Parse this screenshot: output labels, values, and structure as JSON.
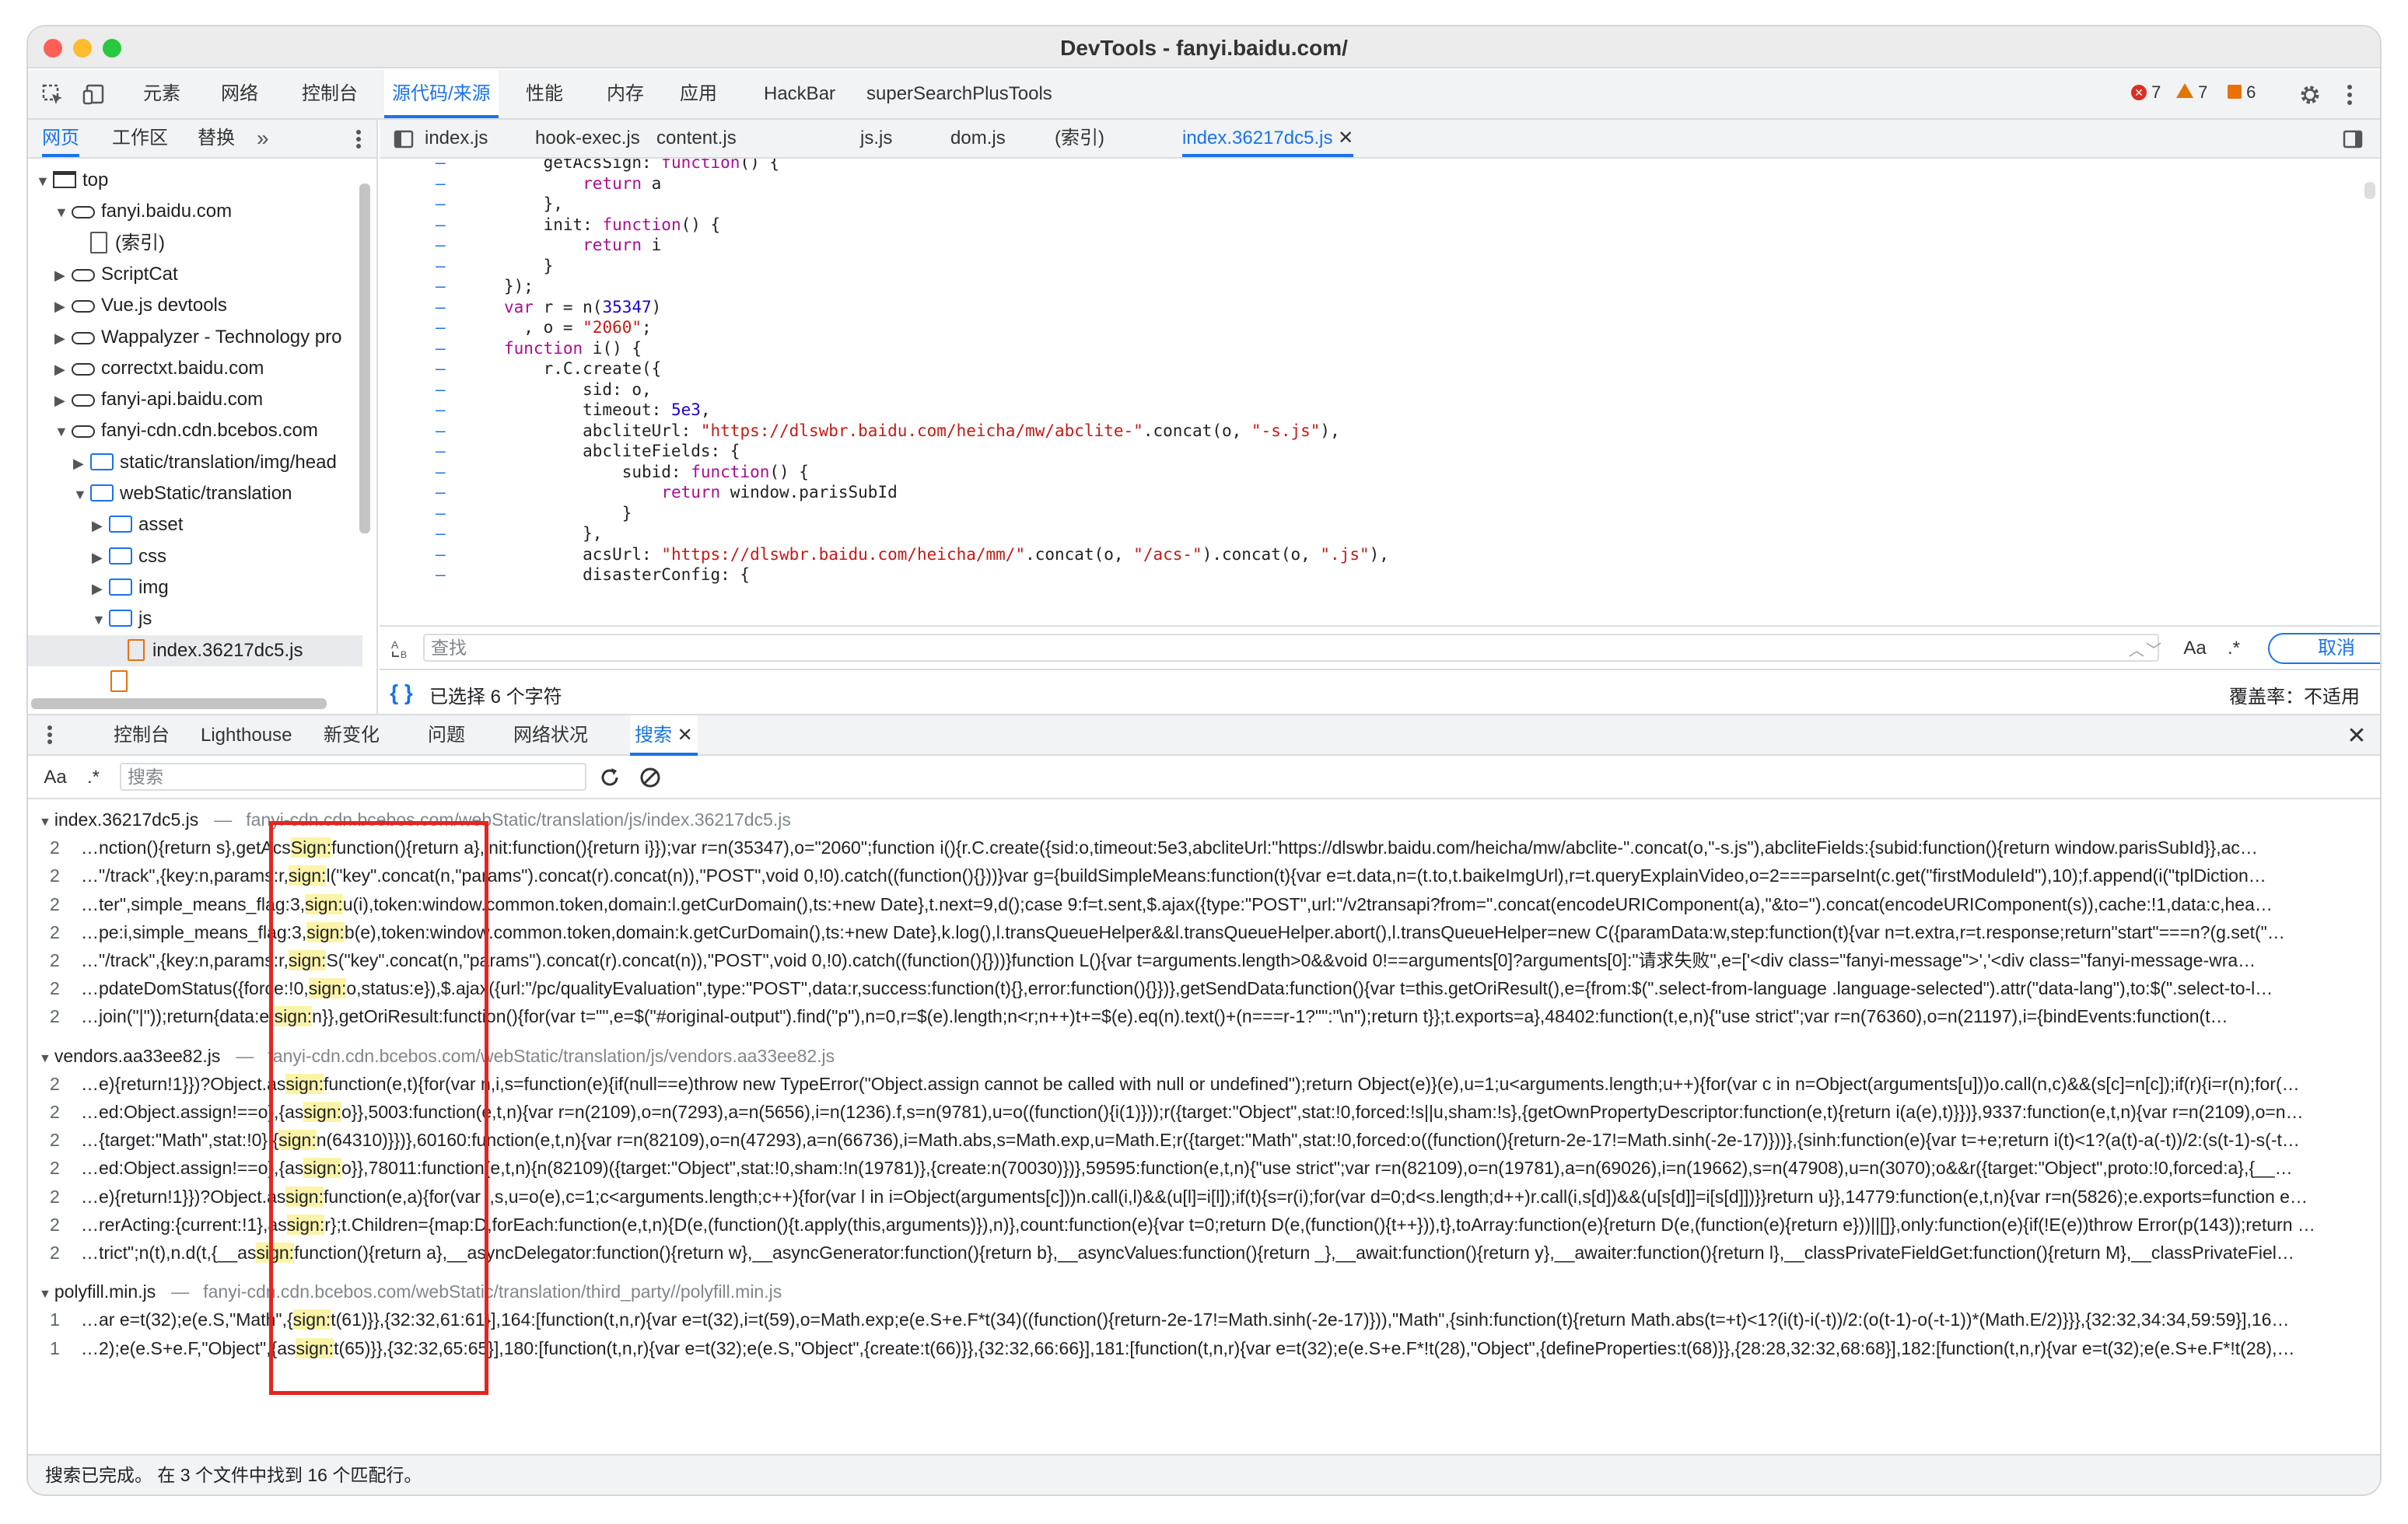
{
  "window": {
    "title": "DevTools - fanyi.baidu.com/"
  },
  "main_tabs": [
    "元素",
    "网络",
    "控制台",
    "源代码/来源",
    "性能",
    "内存",
    "应用",
    "HackBar",
    "superSearchPlusTools"
  ],
  "main_active": "源代码/来源",
  "badges": {
    "errors": "7",
    "warnings": "7",
    "issues": "6"
  },
  "left_tabs": [
    "网页",
    "工作区",
    "替换"
  ],
  "left_more": "»",
  "editor_tabs": [
    "index.js",
    "hook-exec.js",
    "content.js",
    "js.js",
    "dom.js",
    "(索引)",
    "index.36217dc5.js"
  ],
  "tree": [
    {
      "label": "top",
      "indent": 0,
      "arrow": "▼",
      "icon": "frame"
    },
    {
      "label": "fanyi.baidu.com",
      "indent": 1,
      "arrow": "▼",
      "icon": "cloud"
    },
    {
      "label": "(索引)",
      "indent": 2,
      "arrow": "",
      "icon": "file"
    },
    {
      "label": "ScriptCat",
      "indent": 1,
      "arrow": "▶",
      "icon": "cloud"
    },
    {
      "label": "Vue.js devtools",
      "indent": 1,
      "arrow": "▶",
      "icon": "cloud"
    },
    {
      "label": "Wappalyzer - Technology pro",
      "indent": 1,
      "arrow": "▶",
      "icon": "cloud"
    },
    {
      "label": "correctxt.baidu.com",
      "indent": 1,
      "arrow": "▶",
      "icon": "cloud"
    },
    {
      "label": "fanyi-api.baidu.com",
      "indent": 1,
      "arrow": "▶",
      "icon": "cloud"
    },
    {
      "label": "fanyi-cdn.cdn.bcebos.com",
      "indent": 1,
      "arrow": "▼",
      "icon": "cloud"
    },
    {
      "label": "static/translation/img/head",
      "indent": 2,
      "arrow": "▶",
      "icon": "folder"
    },
    {
      "label": "webStatic/translation",
      "indent": 2,
      "arrow": "▼",
      "icon": "folder"
    },
    {
      "label": "asset",
      "indent": 3,
      "arrow": "▶",
      "icon": "folder"
    },
    {
      "label": "css",
      "indent": 3,
      "arrow": "▶",
      "icon": "folder"
    },
    {
      "label": "img",
      "indent": 3,
      "arrow": "▶",
      "icon": "folder"
    },
    {
      "label": "js",
      "indent": 3,
      "arrow": "▼",
      "icon": "folder"
    },
    {
      "label": "index.36217dc5.js",
      "indent": 4,
      "arrow": "",
      "icon": "orangefile"
    }
  ],
  "code_lines": [
    [
      [
        "    getAcsSign: ",
        "p"
      ],
      [
        "function",
        "k"
      ],
      [
        "() {",
        "p"
      ]
    ],
    [
      [
        "        ",
        "p"
      ],
      [
        "return",
        "k"
      ],
      [
        " a",
        "p"
      ]
    ],
    [
      [
        "    },",
        "p"
      ]
    ],
    [
      [
        "    init: ",
        "p"
      ],
      [
        "function",
        "k"
      ],
      [
        "() {",
        "p"
      ]
    ],
    [
      [
        "        ",
        "p"
      ],
      [
        "return",
        "k"
      ],
      [
        " i",
        "p"
      ]
    ],
    [
      [
        "    }",
        "p"
      ]
    ],
    [
      [
        "});",
        "p"
      ]
    ],
    [
      [
        "var",
        "k"
      ],
      [
        " r = n(",
        "p"
      ],
      [
        "35347",
        "n"
      ],
      [
        ")",
        "p"
      ]
    ],
    [
      [
        "  , o = ",
        "p"
      ],
      [
        "\"2060\"",
        "s"
      ],
      [
        ";",
        "p"
      ]
    ],
    [
      [
        "function",
        "k"
      ],
      [
        " i() {",
        "p"
      ]
    ],
    [
      [
        "    r.C.create({",
        "p"
      ]
    ],
    [
      [
        "        sid: o,",
        "p"
      ]
    ],
    [
      [
        "        timeout: ",
        "p"
      ],
      [
        "5e3",
        "n"
      ],
      [
        ",",
        "p"
      ]
    ],
    [
      [
        "        abcliteUrl: ",
        "p"
      ],
      [
        "\"https://dlswbr.baidu.com/heicha/mw/abclite-\"",
        "s"
      ],
      [
        ".concat(o, ",
        "p"
      ],
      [
        "\"-s.js\"",
        "s"
      ],
      [
        "),",
        "p"
      ]
    ],
    [
      [
        "        abcliteFields: {",
        "p"
      ]
    ],
    [
      [
        "            subid: ",
        "p"
      ],
      [
        "function",
        "k"
      ],
      [
        "() {",
        "p"
      ]
    ],
    [
      [
        "                ",
        "p"
      ],
      [
        "return",
        "k"
      ],
      [
        " window.parisSubId",
        "p"
      ]
    ],
    [
      [
        "            }",
        "p"
      ]
    ],
    [
      [
        "        },",
        "p"
      ]
    ],
    [
      [
        "        acsUrl: ",
        "p"
      ],
      [
        "\"https://dlswbr.baidu.com/heicha/mm/\"",
        "s"
      ],
      [
        ".concat(o, ",
        "p"
      ],
      [
        "\"/acs-\"",
        "s"
      ],
      [
        ").concat(o, ",
        "p"
      ],
      [
        "\".js\"",
        "s"
      ],
      [
        "),",
        "p"
      ]
    ],
    [
      [
        "        disasterConfig: {",
        "p"
      ]
    ]
  ],
  "find": {
    "placeholder": "查找",
    "aa": "Aa",
    "regex": ".*",
    "cancel": "取消"
  },
  "status": {
    "selected": "已选择 6 个字符",
    "coverage": "覆盖率：不适用"
  },
  "drawer_tabs": [
    "控制台",
    "Lighthouse",
    "新变化",
    "问题",
    "网络状况",
    "搜索"
  ],
  "drawer_active": "搜索",
  "search": {
    "aa": "Aa",
    "regex": ".*",
    "placeholder": "搜索"
  },
  "results": [
    {
      "file": "index.36217dc5.js",
      "path": "fanyi-cdn.cdn.bcebos.com/webStatic/translation/js/index.36217dc5.js",
      "lines": [
        {
          "n": "2",
          "pre": "…nction(){return s},getAcs",
          "hl": "Sign:",
          "post": "function(){return a},init:function(){return i}});var r=n(35347),o=\"2060\";function i(){r.C.create({sid:o,timeout:5e3,abcliteUrl:\"https://dlswbr.baidu.com/heicha/mw/abclite-\".concat(o,\"-s.js\"),abcliteFields:{subid:function(){return window.parisSubId}},ac…"
        },
        {
          "n": "2",
          "pre": "…\"/track\",{key:n,params:r,",
          "hl": "sign:",
          "post": "l(\"key\".concat(n,\"params\").concat(r).concat(n)),\"POST\",void 0,!0).catch((function(){}))}var g={buildSimpleMeans:function(t){var e=t.data,n=(t.to,t.baikeImgUrl),r=t.queryExplainVideo,o=2===parseInt(c.get(\"firstModuleId\"),10);f.append(i(\"tplDiction…"
        },
        {
          "n": "2",
          "pre": "…ter\",simple_means_flag:3,",
          "hl": "sign:",
          "post": "u(i),token:window.common.token,domain:l.getCurDomain(),ts:+new Date},t.next=9,d();case 9:f=t.sent,$.ajax({type:\"POST\",url:\"/v2transapi?from=\".concat(encodeURIComponent(a),\"&to=\").concat(encodeURIComponent(s)),cache:!1,data:c,hea…"
        },
        {
          "n": "2",
          "pre": "…pe:i,simple_means_flag:3,",
          "hl": "sign:",
          "post": "b(e),token:window.common.token,domain:k.getCurDomain(),ts:+new Date},k.log(),l.transQueueHelper&&l.transQueueHelper.abort(),l.transQueueHelper=new C({paramData:w,step:function(t){var n=t.extra,r=t.response;return\"start\"===n?(g.set(\"…"
        },
        {
          "n": "2",
          "pre": "…\"/track\",{key:n,params:r,",
          "hl": "sign:",
          "post": "S(\"key\".concat(n,\"params\").concat(r).concat(n)),\"POST\",void 0,!0).catch((function(){}))}function L(){var t=arguments.length>0&&void 0!==arguments[0]?arguments[0]:\"请求失败\",e=['<div class=\"fanyi-message\">','<div class=\"fanyi-message-wra…"
        },
        {
          "n": "2",
          "pre": "…pdateDomStatus({force:!0,",
          "hl": "sign:",
          "post": "o,status:e}),$.ajax({url:\"/pc/qualityEvaluation\",type:\"POST\",data:r,success:function(t){},error:function(){}})},getSendData:function(){var t=this.getOriResult(),e={from:$(\".select-from-language .language-selected\").attr(\"data-lang\"),to:$(\".select-to-l…"
        },
        {
          "n": "2",
          "pre": "…join(\"|\"));return{data:e,",
          "hl": "sign:",
          "post": "n}},getOriResult:function(){for(var t=\"\",e=$(\"#original-output\").find(\"p\"),n=0,r=$(e).length;n<r;n++)t+=$(e).eq(n).text()+(n===r-1?\"\":\"\\n\");return t}};t.exports=a},48402:function(t,e,n){\"use strict\";var r=n(76360),o=n(21197),i={bindEvents:function(t…"
        }
      ]
    },
    {
      "file": "vendors.aa33ee82.js",
      "path": "fanyi-cdn.cdn.bcebos.com/webStatic/translation/js/vendors.aa33ee82.js",
      "lines": [
        {
          "n": "2",
          "pre": "…e){return!1}})?Object.as",
          "hl": "sign:",
          "post": "function(e,t){for(var n,i,s=function(e){if(null==e)throw new TypeError(\"Object.assign cannot be called with null or undefined\");return Object(e)}(e),u=1;u<arguments.length;u++){for(var c in n=Object(arguments[u]))o.call(n,c)&&(s[c]=n[c]);if(r){i=r(n);for(…"
        },
        {
          "n": "2",
          "pre": "…ed:Object.assign!==o},{as",
          "hl": "sign:",
          "post": "o}},5003:function(e,t,n){var r=n(2109),o=n(7293),a=n(5656),i=n(1236).f,s=n(9781),u=o((function(){i(1)}));r({target:\"Object\",stat:!0,forced:!s||u,sham:!s},{getOwnPropertyDescriptor:function(e,t){return i(a(e),t)}})},9337:function(e,t,n){var r=n(2109),o=n…"
        },
        {
          "n": "2",
          "pre": "…{target:\"Math\",stat:!0},{",
          "hl": "sign:",
          "post": "n(64310)}})},60160:function(e,t,n){var r=n(82109),o=n(47293),a=n(66736),i=Math.abs,s=Math.exp,u=Math.E;r({target:\"Math\",stat:!0,forced:o((function(){return-2e-17!=Math.sinh(-2e-17)}))},{sinh:function(e){var t=+e;return i(t)<1?(a(t)-a(-t))/2:(s(t-1)-s(-t…"
        },
        {
          "n": "2",
          "pre": "…ed:Object.assign!==o},{as",
          "hl": "sign:",
          "post": "o}},78011:function(e,t,n){n(82109)({target:\"Object\",stat:!0,sham:!n(19781)},{create:n(70030)})},59595:function(e,t,n){\"use strict\";var r=n(82109),o=n(19781),a=n(69026),i=n(19662),s=n(47908),u=n(3070);o&&r({target:\"Object\",proto:!0,forced:a},{__…"
        },
        {
          "n": "2",
          "pre": "…e){return!1}})?Object.as",
          "hl": "sign:",
          "post": "function(e,a){for(var i,s,u=o(e),c=1;c<arguments.length;c++){for(var l in i=Object(arguments[c]))n.call(i,l)&&(u[l]=i[l]);if(t){s=r(i);for(var d=0;d<s.length;d++)r.call(i,s[d])&&(u[s[d]]=i[s[d]])}}return u}},14779:function(e,t,n){var r=n(5826);e.exports=function e…"
        },
        {
          "n": "2",
          "pre": "…rerActing:{current:!1},as",
          "hl": "sign:",
          "post": "r};t.Children={map:D,forEach:function(e,t,n){D(e,(function(){t.apply(this,arguments)}),n)},count:function(e){var t=0;return D(e,(function(){t++})),t},toArray:function(e){return D(e,(function(e){return e}))||[]},only:function(e){if(!E(e))throw Error(p(143));return …"
        },
        {
          "n": "2",
          "pre": "…trict\";n(t),n.d(t,{__as",
          "hl": "sign:",
          "post": "function(){return a},__asyncDelegator:function(){return w},__asyncGenerator:function(){return b},__asyncValues:function(){return _},__await:function(){return y},__awaiter:function(){return l},__classPrivateFieldGet:function(){return M},__classPrivateFiel…"
        }
      ]
    },
    {
      "file": "polyfill.min.js",
      "path": "fanyi-cdn.cdn.bcebos.com/webStatic/translation/third_party//polyfill.min.js",
      "lines": [
        {
          "n": "1",
          "pre": "…ar e=t(32);e(e.S,\"Math\",{",
          "hl": "sign:",
          "post": "t(61)}},{32:32,61:61}],164:[function(t,n,r){var e=t(32),i=t(59),o=Math.exp;e(e.S+e.F*t(34)((function(){return-2e-17!=Math.sinh(-2e-17)})),\"Math\",{sinh:function(t){return Math.abs(t=+t)<1?(i(t)-i(-t))/2:(o(t-1)-o(-t-1))*(Math.E/2)}}},{32:32,34:34,59:59}],16…"
        },
        {
          "n": "1",
          "pre": "…2);e(e.S+e.F,\"Object\",{as",
          "hl": "sign:",
          "post": "t(65)}},{32:32,65:65}],180:[function(t,n,r){var e=t(32);e(e.S,\"Object\",{create:t(66)}},{32:32,66:66}],181:[function(t,n,r){var e=t(32);e(e.S+e.F*!t(28),\"Object\",{defineProperties:t(68)}},{28:28,32:32,68:68}],182:[function(t,n,r){var e=t(32);e(e.S+e.F*!t(28),…"
        }
      ]
    }
  ],
  "footer": "搜索已完成。 在 3 个文件中找到 16 个匹配行。"
}
